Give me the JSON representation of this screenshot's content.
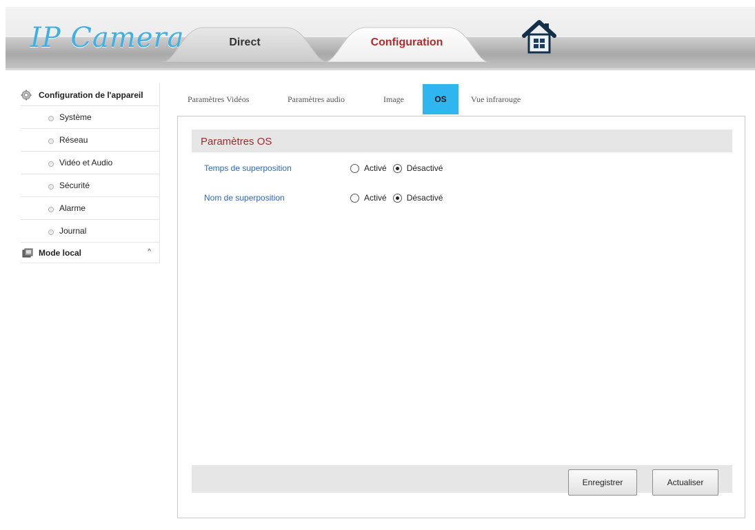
{
  "header": {
    "logo_text": "IP Camera",
    "tabs": [
      {
        "label": "Direct"
      },
      {
        "label": "Configuration"
      }
    ],
    "home_icon": "house-icon"
  },
  "sidebar": {
    "heading": "Configuration de l'appareil",
    "heading_icon": "gear-icon",
    "items": [
      {
        "label": "Système"
      },
      {
        "label": "Réseau"
      },
      {
        "label": "Vidéo et Audio"
      },
      {
        "label": "Sécurité"
      },
      {
        "label": "Alarme"
      },
      {
        "label": "Journal"
      }
    ],
    "local": {
      "label": "Mode local",
      "caret": "^",
      "icon": "local-storage-icon"
    }
  },
  "subtabs": [
    {
      "label": "Paramètres Vidéos"
    },
    {
      "label": "Paramètres audio"
    },
    {
      "label": "Image"
    },
    {
      "label": "OS",
      "active": true
    },
    {
      "label": "Vue infrarouge"
    }
  ],
  "panel": {
    "title": "Paramètres OS",
    "rows": [
      {
        "label": "Temps de superposition",
        "option_on": "Activé",
        "option_off": "Désactivé",
        "selected": "Désactivé"
      },
      {
        "label": "Nom de superposition",
        "option_on": "Activé",
        "option_off": "Désactivé",
        "selected": "Désactivé"
      }
    ],
    "save_label": "Enregistrer",
    "refresh_label": "Actualiser"
  },
  "colors": {
    "accent_tab": "#2fb6ee",
    "title_red": "#9b2b2b",
    "label_blue": "#2b67c9",
    "logo_blue": "#3fb0e6"
  }
}
